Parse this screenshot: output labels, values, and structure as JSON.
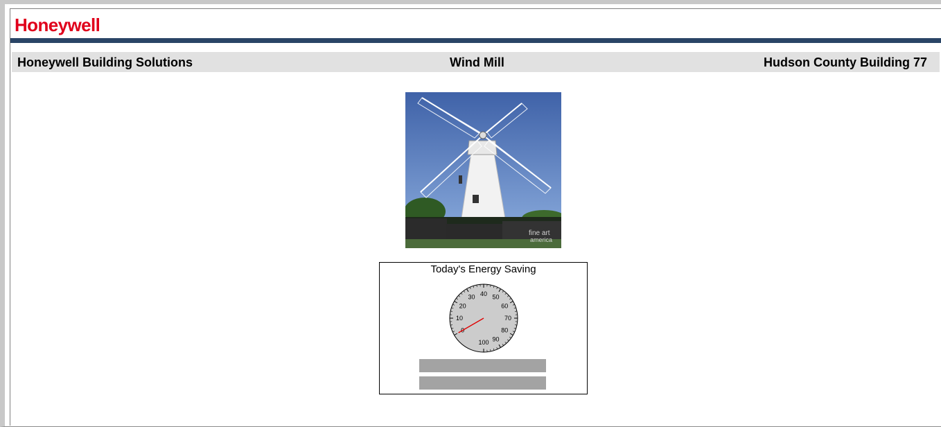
{
  "brand": {
    "logo_text": "Honeywell",
    "logo_color": "#e0001b",
    "bar_color": "#2a4566"
  },
  "header": {
    "left": "Honeywell Building Solutions",
    "center": "Wind Mill",
    "right": "Hudson County Building 77"
  },
  "photo": {
    "icon": "windmill-photo",
    "watermark_line1": "fine art",
    "watermark_line2": "america"
  },
  "energy_panel": {
    "title": "Today's Energy Saving",
    "gauge": {
      "min": 0,
      "max": 100,
      "value": 0,
      "tick_labels": [
        "0",
        "10",
        "20",
        "30",
        "40",
        "50",
        "60",
        "70",
        "80",
        "90",
        "100"
      ]
    },
    "value_field_1": "",
    "value_field_2": ""
  }
}
